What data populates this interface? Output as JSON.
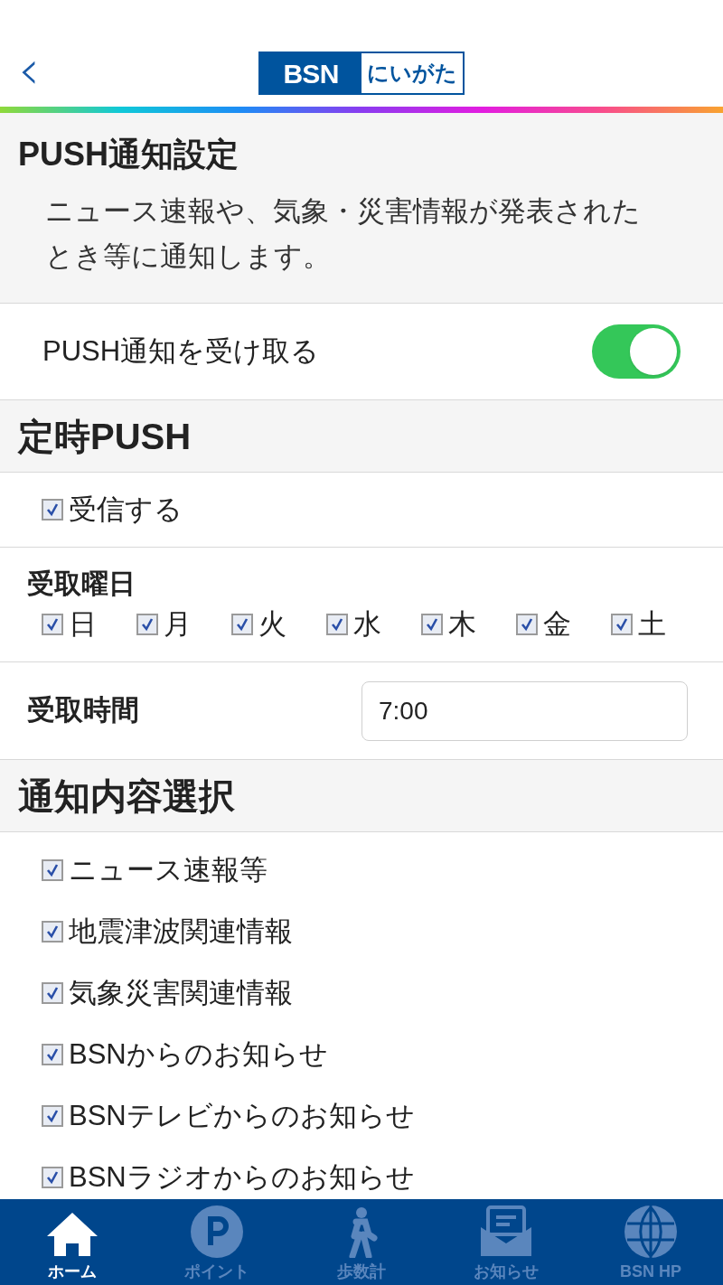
{
  "header": {
    "back": "‹",
    "logo": {
      "brand": "BSN",
      "region": "にいがた"
    }
  },
  "push_settings": {
    "title": "PUSH通知設定",
    "description": "ニュース速報や、気象・災害情報が発表されたとき等に通知します。"
  },
  "push_toggle": {
    "label": "PUSH通知を受け取る",
    "on": true
  },
  "scheduled": {
    "title": "定時PUSH",
    "receive": {
      "label": "受信する",
      "checked": true
    },
    "days_label": "受取曜日",
    "days": [
      {
        "label": "日",
        "checked": true
      },
      {
        "label": "月",
        "checked": true
      },
      {
        "label": "火",
        "checked": true
      },
      {
        "label": "水",
        "checked": true
      },
      {
        "label": "木",
        "checked": true
      },
      {
        "label": "金",
        "checked": true
      },
      {
        "label": "土",
        "checked": true
      }
    ],
    "time_label": "受取時間",
    "time_value": "7:00"
  },
  "content": {
    "title": "通知内容選択",
    "items": [
      {
        "label": "ニュース速報等",
        "checked": true
      },
      {
        "label": "地震津波関連情報",
        "checked": true
      },
      {
        "label": "気象災害関連情報",
        "checked": true
      },
      {
        "label": "BSNからのお知らせ",
        "checked": true
      },
      {
        "label": "BSNテレビからのお知らせ",
        "checked": true
      },
      {
        "label": "BSNラジオからのお知らせ",
        "checked": true
      }
    ]
  },
  "tab_bar": [
    {
      "kind": "home",
      "label": "ホーム",
      "selected": true
    },
    {
      "kind": "points",
      "label": "ポイント",
      "selected": false
    },
    {
      "kind": "steps",
      "label": "歩数計",
      "selected": false
    },
    {
      "kind": "news",
      "label": "お知らせ",
      "selected": false
    },
    {
      "kind": "web",
      "label": "BSN HP",
      "selected": false
    }
  ]
}
